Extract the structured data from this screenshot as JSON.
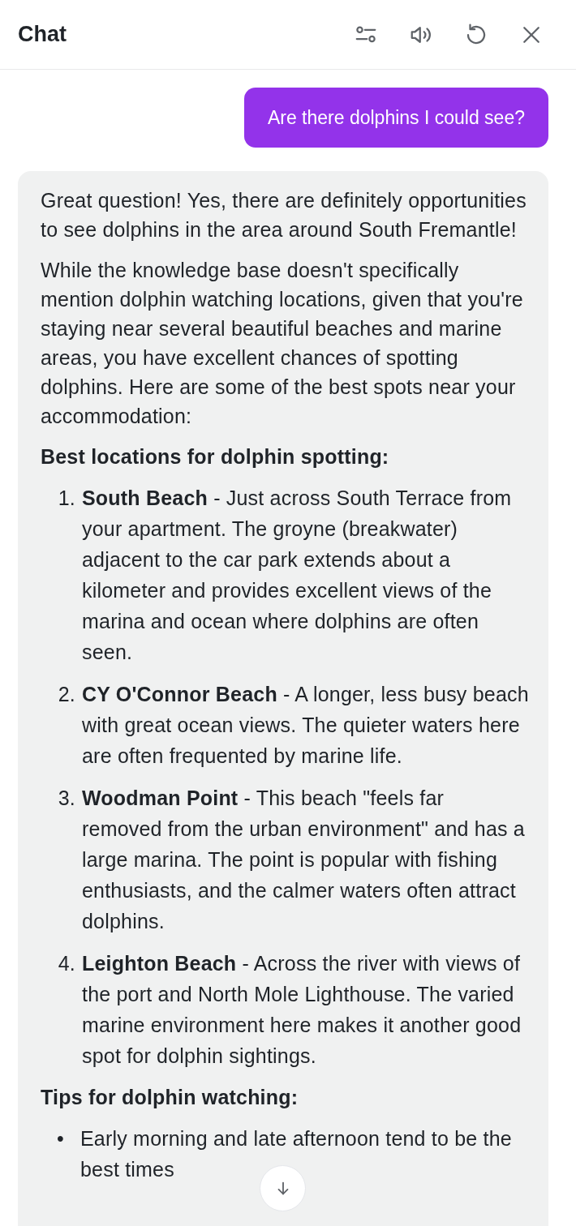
{
  "header": {
    "title": "Chat"
  },
  "messages": [
    {
      "kind": "user",
      "text": "Are there dolphins I could see?"
    },
    {
      "kind": "assistant",
      "blocks": [
        {
          "kind": "paragraph",
          "text": "Great question! Yes, there are definitely opportunities to see dolphins in the area around South Fremantle!"
        },
        {
          "kind": "paragraph",
          "text": "While the knowledge base doesn't specifically mention dolphin watching locations, given that you're staying near several beautiful beaches and marine areas, you have excellent chances of spotting dolphins. Here are some of the best spots near your accommodation:"
        },
        {
          "kind": "heading",
          "text": "Best locations for dolphin spotting:"
        },
        {
          "kind": "ordered",
          "items": [
            {
              "marker": "1.",
              "text": "**South Beach** - Just across South Terrace from your apartment. The groyne (breakwater) adjacent to the car park extends about a kilometer and provides excellent views of the marina and ocean where dolphins are often seen."
            },
            {
              "marker": "2.",
              "text": "**CY O'Connor Beach** - A longer, less busy beach with great ocean views. The quieter waters here are often frequented by marine life."
            },
            {
              "marker": "3.",
              "text": "**Woodman Point** - This beach \"feels far removed from the urban environment\" and has a large marina. The point is popular with fishing enthusiasts, and the calmer waters often attract dolphins."
            },
            {
              "marker": "4.",
              "text": "**Leighton Beach** - Across the river with views of the port and North Mole Lighthouse. The varied marine environment here makes it another good spot for dolphin sightings."
            }
          ]
        },
        {
          "kind": "heading",
          "text": "Tips for dolphin watching:"
        },
        {
          "kind": "bullets",
          "items": [
            {
              "marker": "•",
              "text": "Early morning and late afternoon tend to be the best times"
            }
          ]
        }
      ]
    }
  ]
}
